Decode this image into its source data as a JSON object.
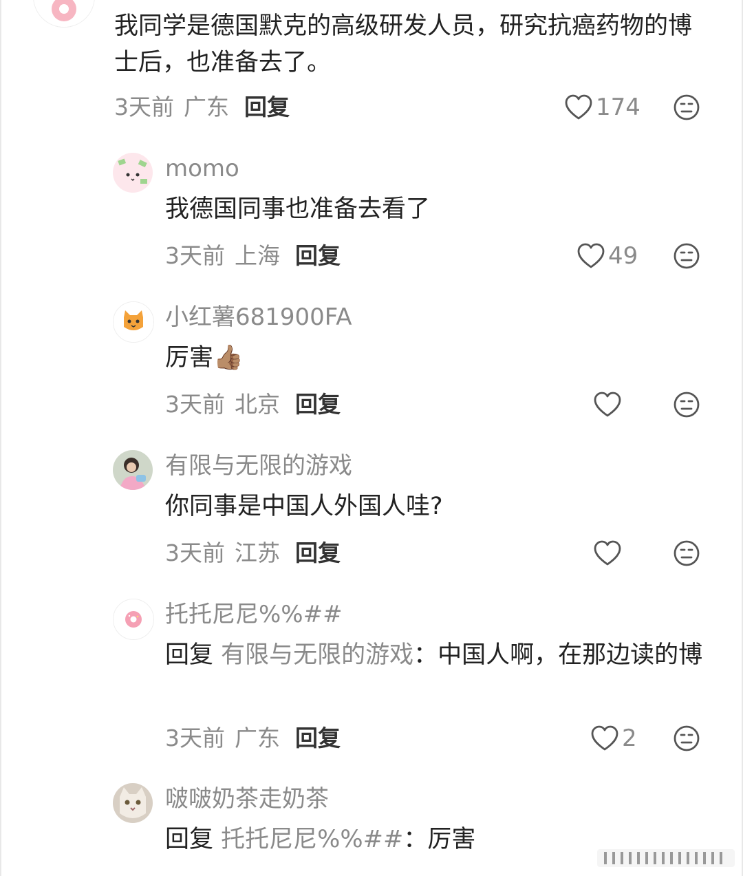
{
  "comments": [
    {
      "username": "",
      "text": "我同学是德国默克的高级研发人员，研究抗癌药物的博士后，也准备去了。",
      "time": "3天前",
      "location": "广东",
      "reply_label": "回复",
      "likes": "174"
    },
    {
      "username": "momo",
      "text": "我德国同事也准备去看了",
      "time": "3天前",
      "location": "上海",
      "reply_label": "回复",
      "likes": "49"
    },
    {
      "username": "小红薯681900FA",
      "text": "厉害👍🏽",
      "time": "3天前",
      "location": "北京",
      "reply_label": "回复",
      "likes": ""
    },
    {
      "username": "有限与无限的游戏",
      "text": "你同事是中国人外国人哇?",
      "time": "3天前",
      "location": "江苏",
      "reply_label": "回复",
      "likes": ""
    },
    {
      "username": "托托尼尼%%##",
      "reply_prefix": "回复",
      "reply_target": "有限与无限的游戏",
      "text": "：中国人啊，在那边读的博",
      "time": "3天前",
      "location": "广东",
      "reply_label": "回复",
      "likes": "2"
    },
    {
      "username": "啵啵奶茶走奶茶",
      "reply_prefix": "回复",
      "reply_target": "托托尼尼%%##",
      "text": "：厉害"
    }
  ],
  "icons": {
    "like": "heart-outline-icon",
    "dislike": "neutral-face-icon"
  },
  "colors": {
    "secondary_text": "#8a8a8a",
    "primary_text": "#222222",
    "icon_stroke": "#555555"
  }
}
